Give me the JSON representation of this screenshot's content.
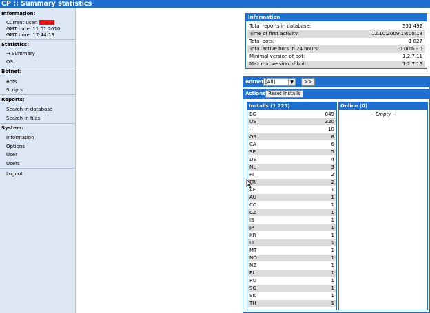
{
  "title": "CP :: Summary statistics",
  "sidebar": {
    "information_title": "Information:",
    "current_user_label": "Current user:",
    "gmt_date": "GMT date: 11.01.2010",
    "gmt_time": "GMT time: 17:44:13",
    "statistics_title": "Statistics:",
    "summary": "→ Summary",
    "os": "OS",
    "botnet_title": "Botnet:",
    "bots": "Bots",
    "scripts": "Scripts",
    "reports_title": "Reports:",
    "search_db": "Search in database",
    "search_files": "Search in files",
    "system_title": "System:",
    "sys_information": "Information",
    "options": "Options",
    "user": "User",
    "users": "Users",
    "logout": "Logout"
  },
  "info": {
    "header": "Information",
    "rows": [
      {
        "label": "Total reports in database:",
        "value": "551 492"
      },
      {
        "label": "Time of first activity:",
        "value": "12.10.2009 18:00:18"
      },
      {
        "label": "Total bots:",
        "value": "1 827"
      },
      {
        "label": "Total active bots in 24 hours:",
        "value": "0.00% - 0"
      },
      {
        "label": "Minimal version of bot:",
        "value": "1.2.7.11"
      },
      {
        "label": "Maximal version of bot:",
        "value": "1.2.7.16"
      }
    ]
  },
  "botnet": {
    "label": "Botnet:",
    "selected": "[All]",
    "go_label": ">>",
    "actions_label": "Actions:",
    "reset_label": "Reset Installs"
  },
  "installs": {
    "header": "Installs (1 225)",
    "rows": [
      {
        "country": "BG",
        "count": "849"
      },
      {
        "country": "US",
        "count": "320"
      },
      {
        "country": "--",
        "count": "10"
      },
      {
        "country": "GB",
        "count": "8"
      },
      {
        "country": "CA",
        "count": "6"
      },
      {
        "country": "SE",
        "count": "5"
      },
      {
        "country": "DE",
        "count": "4"
      },
      {
        "country": "NL",
        "count": "3"
      },
      {
        "country": "FI",
        "count": "2"
      },
      {
        "country": "FR",
        "count": "2"
      },
      {
        "country": "AE",
        "count": "1"
      },
      {
        "country": "AU",
        "count": "1"
      },
      {
        "country": "CO",
        "count": "1"
      },
      {
        "country": "CZ",
        "count": "1"
      },
      {
        "country": "IS",
        "count": "1"
      },
      {
        "country": "JP",
        "count": "1"
      },
      {
        "country": "KR",
        "count": "1"
      },
      {
        "country": "LT",
        "count": "1"
      },
      {
        "country": "MT",
        "count": "1"
      },
      {
        "country": "NO",
        "count": "1"
      },
      {
        "country": "NZ",
        "count": "1"
      },
      {
        "country": "PL",
        "count": "1"
      },
      {
        "country": "RU",
        "count": "1"
      },
      {
        "country": "SG",
        "count": "1"
      },
      {
        "country": "SK",
        "count": "1"
      },
      {
        "country": "TH",
        "count": "1"
      }
    ]
  },
  "online": {
    "header": "Online (0)",
    "empty": "-- Empty --"
  }
}
